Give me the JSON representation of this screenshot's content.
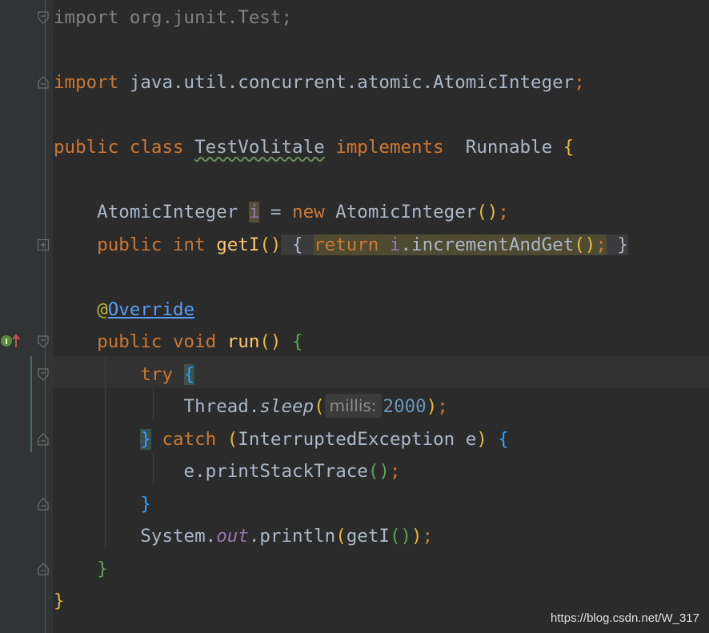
{
  "editor": {
    "lines": [
      [
        {
          "t": "import",
          "c": "kw dim"
        },
        {
          "t": " org.junit.Test;",
          "c": "dim"
        }
      ],
      [],
      [
        {
          "t": "import",
          "c": "kw"
        },
        {
          "t": " java.util.concurrent.atomic.AtomicInteger",
          "c": "cls"
        },
        {
          "t": ";",
          "c": "kw"
        }
      ],
      [],
      [
        {
          "t": "public",
          "c": "kw"
        },
        {
          "t": " ",
          "c": ""
        },
        {
          "t": "class",
          "c": "kw"
        },
        {
          "t": " ",
          "c": ""
        },
        {
          "t": "TestVolitale",
          "c": "cls typo"
        },
        {
          "t": " ",
          "c": ""
        },
        {
          "t": "implements",
          "c": "kw"
        },
        {
          "t": "  Runnable ",
          "c": "cls"
        },
        {
          "t": "{",
          "c": "p1"
        }
      ],
      [],
      [
        {
          "t": "    AtomicInteger ",
          "c": "cls"
        },
        {
          "t": "i",
          "c": "fld hl-var"
        },
        {
          "t": " = ",
          "c": "cls"
        },
        {
          "t": "new",
          "c": "kw"
        },
        {
          "t": " AtomicInteger",
          "c": "cls"
        },
        {
          "t": "()",
          "c": "p1"
        },
        {
          "t": ";",
          "c": "kw"
        }
      ],
      [
        {
          "t": "    ",
          "c": ""
        },
        {
          "t": "public",
          "c": "kw"
        },
        {
          "t": " ",
          "c": ""
        },
        {
          "t": "int",
          "c": "kw"
        },
        {
          "t": " ",
          "c": ""
        },
        {
          "t": "getI",
          "c": "method"
        },
        {
          "t": "()",
          "c": "p1"
        },
        {
          "t": " { ",
          "c": "cls fold-region"
        },
        {
          "t": "return",
          "c": "kw fold-inner"
        },
        {
          "t": " ",
          "c": "fold-inner"
        },
        {
          "t": "i",
          "c": "fld fold-inner"
        },
        {
          "t": ".incrementAndGet",
          "c": "cls fold-inner"
        },
        {
          "t": "()",
          "c": "p1 fold-inner"
        },
        {
          "t": ";",
          "c": "kw fold-inner"
        },
        {
          "t": " }",
          "c": "cls fold-region"
        }
      ],
      [],
      [
        {
          "t": "    ",
          "c": ""
        },
        {
          "t": "@",
          "c": "ann"
        },
        {
          "t": "Override",
          "c": "link"
        }
      ],
      [
        {
          "t": "    ",
          "c": ""
        },
        {
          "t": "public",
          "c": "kw"
        },
        {
          "t": " ",
          "c": ""
        },
        {
          "t": "void",
          "c": "kw"
        },
        {
          "t": " ",
          "c": ""
        },
        {
          "t": "run",
          "c": "method"
        },
        {
          "t": "()",
          "c": "p1"
        },
        {
          "t": " ",
          "c": ""
        },
        {
          "t": "{",
          "c": "p2"
        }
      ],
      [
        {
          "t": "        ",
          "c": ""
        },
        {
          "t": "try",
          "c": "kw"
        },
        {
          "t": " ",
          "c": ""
        },
        {
          "t": "{",
          "c": "p3 brace-match"
        }
      ],
      [
        {
          "t": "            Thread.",
          "c": "cls"
        },
        {
          "t": "sleep",
          "c": "cls italic"
        },
        {
          "t": "(",
          "c": "p1"
        },
        {
          "hint": "millis:"
        },
        {
          "t": "2000",
          "c": "num"
        },
        {
          "t": ")",
          "c": "p1"
        },
        {
          "t": ";",
          "c": "kw"
        }
      ],
      [
        {
          "t": "        ",
          "c": ""
        },
        {
          "t": "}",
          "c": "p3 brace-match"
        },
        {
          "t": " ",
          "c": ""
        },
        {
          "t": "catch",
          "c": "kw"
        },
        {
          "t": " ",
          "c": ""
        },
        {
          "t": "(",
          "c": "p1"
        },
        {
          "t": "InterruptedException e",
          "c": "cls"
        },
        {
          "t": ")",
          "c": "p1"
        },
        {
          "t": " ",
          "c": ""
        },
        {
          "t": "{",
          "c": "p3"
        }
      ],
      [
        {
          "t": "            e.printStackTrace",
          "c": "cls"
        },
        {
          "t": "()",
          "c": "p2"
        },
        {
          "t": ";",
          "c": "kw"
        }
      ],
      [
        {
          "t": "        ",
          "c": ""
        },
        {
          "t": "}",
          "c": "p3"
        }
      ],
      [
        {
          "t": "        System.",
          "c": "cls"
        },
        {
          "t": "out",
          "c": "fld italic"
        },
        {
          "t": ".println",
          "c": "cls"
        },
        {
          "t": "(",
          "c": "p1"
        },
        {
          "t": "getI",
          "c": "cls"
        },
        {
          "t": "()",
          "c": "p2"
        },
        {
          "t": ")",
          "c": "p1"
        },
        {
          "t": ";",
          "c": "kw"
        }
      ],
      [
        {
          "t": "    ",
          "c": ""
        },
        {
          "t": "}",
          "c": "p2"
        }
      ],
      [
        {
          "t": "}",
          "c": "p1"
        }
      ]
    ]
  },
  "gutter": {
    "run_icon": "implements-method-icon",
    "fold_markers": [
      {
        "line": 0,
        "kind": "open"
      },
      {
        "line": 2,
        "kind": "close"
      },
      {
        "line": 7,
        "kind": "expand"
      },
      {
        "line": 10,
        "kind": "open"
      },
      {
        "line": 11,
        "kind": "open"
      },
      {
        "line": 13,
        "kind": "close"
      },
      {
        "line": 15,
        "kind": "close"
      },
      {
        "line": 17,
        "kind": "close"
      }
    ]
  },
  "watermark": "https://blog.csdn.net/W_317",
  "colors": {
    "background": "#2b2b2b",
    "gutter": "#313335",
    "keyword": "#cc7832",
    "text": "#a9b7c6",
    "field": "#9876aa",
    "number": "#6897bb",
    "method": "#ffc66d",
    "annotation": "#bbb529"
  }
}
